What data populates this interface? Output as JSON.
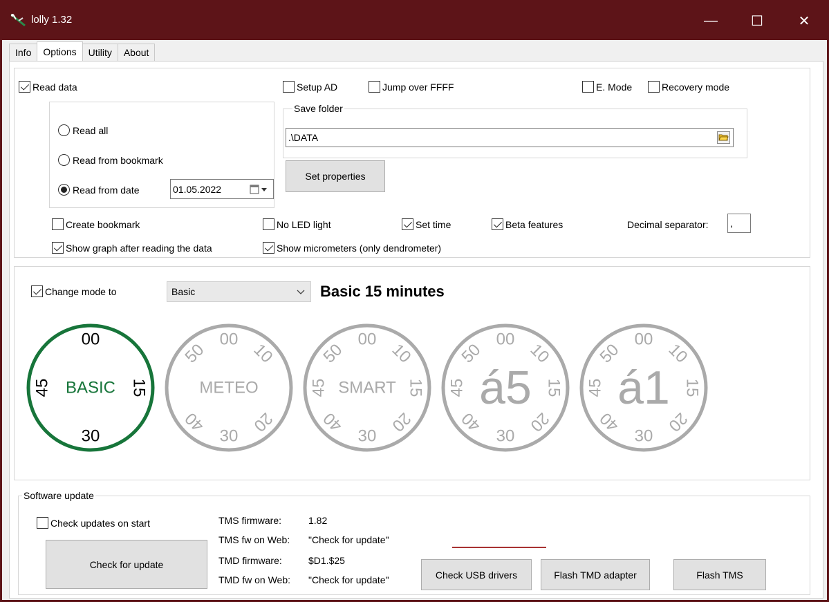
{
  "window": {
    "title": "lolly 1.32",
    "min_glyph": "—",
    "max_glyph": "☐",
    "close_glyph": "✕"
  },
  "tabs": [
    {
      "label": "Info"
    },
    {
      "label": "Options"
    },
    {
      "label": "Utility"
    },
    {
      "label": "About"
    }
  ],
  "read_data": {
    "read_data_label": "Read data",
    "read_data_checked": true,
    "setup_ad_label": "Setup AD",
    "jump_over_label": "Jump over FFFF",
    "e_mode_label": "E. Mode",
    "recovery_mode_label": "Recovery mode",
    "read_all_label": "Read all",
    "read_bookmark_label": "Read from bookmark",
    "read_date_label": "Read from date",
    "read_date_value": "01.05.2022",
    "save_folder_legend": "Save folder",
    "save_folder_value": ".\\DATA",
    "set_properties_label": "Set properties",
    "create_bookmark_label": "Create bookmark",
    "no_led_label": "No LED light",
    "set_time_label": "Set time",
    "beta_features_label": "Beta features",
    "decimal_separator_label": "Decimal separator:",
    "decimal_separator_value": ",",
    "show_graph_label": "Show graph after reading the data",
    "show_micrometers_label": "Show micrometers (only dendrometer)"
  },
  "mode": {
    "change_mode_label": "Change mode to",
    "selected_mode": "Basic",
    "mode_heading": "Basic 15 minutes",
    "active_color": "#17753a",
    "inactive_color": "#aaaaaa",
    "dials": [
      {
        "center": "BASIC",
        "top": "00",
        "right": "15",
        "bottom": "30",
        "left": "45",
        "active": true
      },
      {
        "center": "METEO",
        "top": "00",
        "tr": "10",
        "br": "20",
        "bottom": "30",
        "bl": "40",
        "tl": "50",
        "active": false
      },
      {
        "center": "SMART",
        "top": "00",
        "tr": "10",
        "right": "15",
        "br": "20",
        "bottom": "30",
        "bl": "40",
        "left": "45",
        "tl": "50",
        "active": false
      },
      {
        "center": "á5",
        "top": "00",
        "tr": "10",
        "right": "15",
        "br": "20",
        "bottom": "30",
        "bl": "40",
        "left": "45",
        "tl": "50",
        "active": false
      },
      {
        "center": "á1",
        "top": "00",
        "tr": "10",
        "right": "15",
        "br": "20",
        "bottom": "30",
        "bl": "40",
        "left": "45",
        "tl": "50",
        "active": false
      }
    ]
  },
  "update": {
    "legend": "Software update",
    "check_on_start_label": "Check updates on start",
    "check_for_update_label": "Check for update",
    "tms_fw_label": "TMS firmware:",
    "tms_fw_value": "1.82",
    "tms_web_label": "TMS fw on Web:",
    "tms_web_value": "\"Check for update\"",
    "tmd_fw_label": "TMD firmware:",
    "tmd_fw_value": "$D1.$25",
    "tmd_web_label": "TMD fw on Web:",
    "tmd_web_value": "\"Check for update\"",
    "usb_drivers_label": "Check USB drivers",
    "flash_tmd_label": "Flash TMD adapter",
    "flash_tms_label": "Flash TMS"
  }
}
